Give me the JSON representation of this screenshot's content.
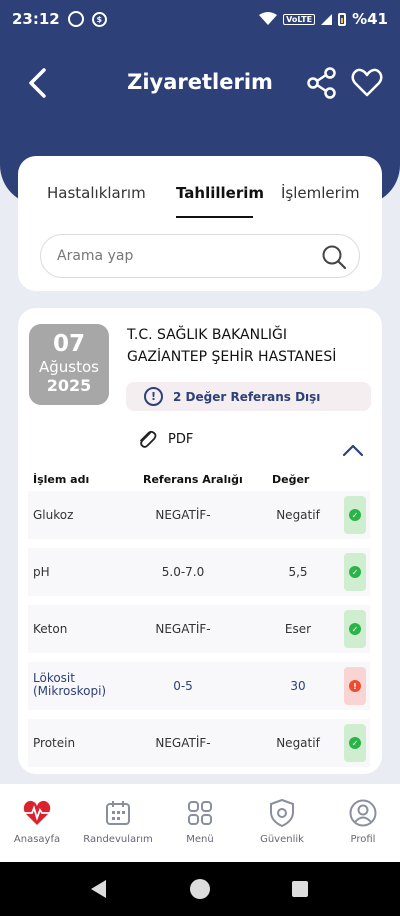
{
  "status_bar": {
    "time": "23:12",
    "volte": "VoLTE",
    "battery": "%41"
  },
  "header": {
    "title": "Ziyaretlerim"
  },
  "tabs": [
    {
      "label": "Hastalıklarım",
      "active": false
    },
    {
      "label": "Tahlillerim",
      "active": true
    },
    {
      "label": "İşlemlerim",
      "active": false
    }
  ],
  "search": {
    "placeholder": "Arama yap"
  },
  "visit": {
    "day": "07",
    "month": "Ağustos",
    "year": "2025",
    "hospital": "T.C. SAĞLIK BAKANLIĞI GAZİANTEP ŞEHİR HASTANESİ",
    "ref_badge": "2 Değer Referans Dışı",
    "pdf_label": "PDF"
  },
  "table": {
    "headers": {
      "name": "İşlem adı",
      "ref": "Referans Aralığı",
      "value": "Değer"
    },
    "rows": [
      {
        "name": "Glukoz",
        "ref": "NEGATİF-",
        "value": "Negatif",
        "status": "ok"
      },
      {
        "name": "pH",
        "ref": "5.0-7.0",
        "value": "5,5",
        "status": "ok"
      },
      {
        "name": "Keton",
        "ref": "NEGATİF-",
        "value": "Eser",
        "status": "ok"
      },
      {
        "name": "Lökosit (Mikroskopi)",
        "ref": "0-5",
        "value": "30",
        "status": "bad"
      },
      {
        "name": "Protein",
        "ref": "NEGATİF-",
        "value": "Negatif",
        "status": "ok"
      }
    ]
  },
  "bottom_nav": {
    "home": "Anasayfa",
    "appointments": "Randevularım",
    "menu": "Menü",
    "security": "Güvenlik",
    "profile": "Profil"
  },
  "colors": {
    "primary": "#2d4178",
    "ok": "#2bb34a",
    "alert": "#ef4b2e",
    "date_badge": "#a7a7a7"
  }
}
